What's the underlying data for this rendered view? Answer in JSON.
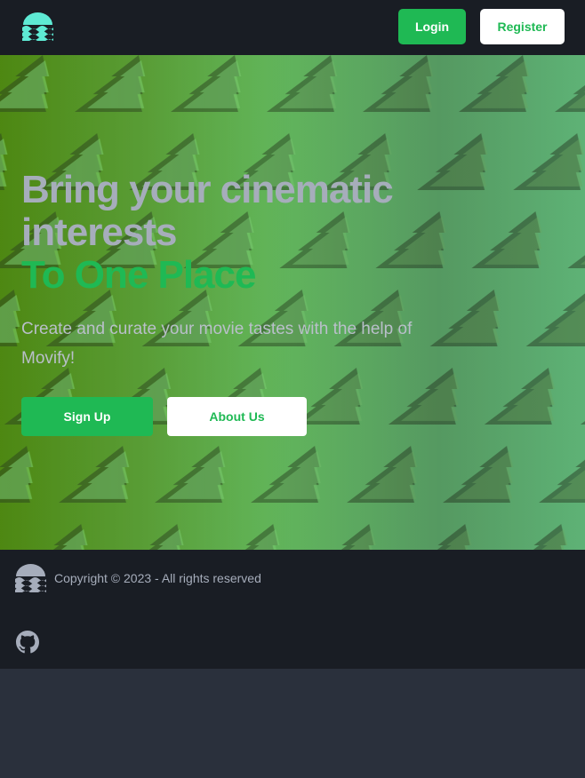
{
  "navbar": {
    "logo_icon": "wave-logo-icon",
    "login_label": "Login",
    "register_label": "Register"
  },
  "hero": {
    "headline_line1": "Bring your cinematic interests",
    "headline_accent": "To One Place",
    "subtitle": "Create and curate your movie tastes with the help of Movify!",
    "signup_label": "Sign Up",
    "about_label": "About Us"
  },
  "footer": {
    "logo_icon": "wave-logo-icon",
    "copyright": "Copyright © 2023 - All rights reserved",
    "github_icon": "github-icon"
  },
  "colors": {
    "accent": "#1fb954",
    "navbar_bg": "#191d24",
    "page_bg": "#2a303c",
    "logo_teal": "#5eead4",
    "text_muted": "#a6adbb"
  }
}
